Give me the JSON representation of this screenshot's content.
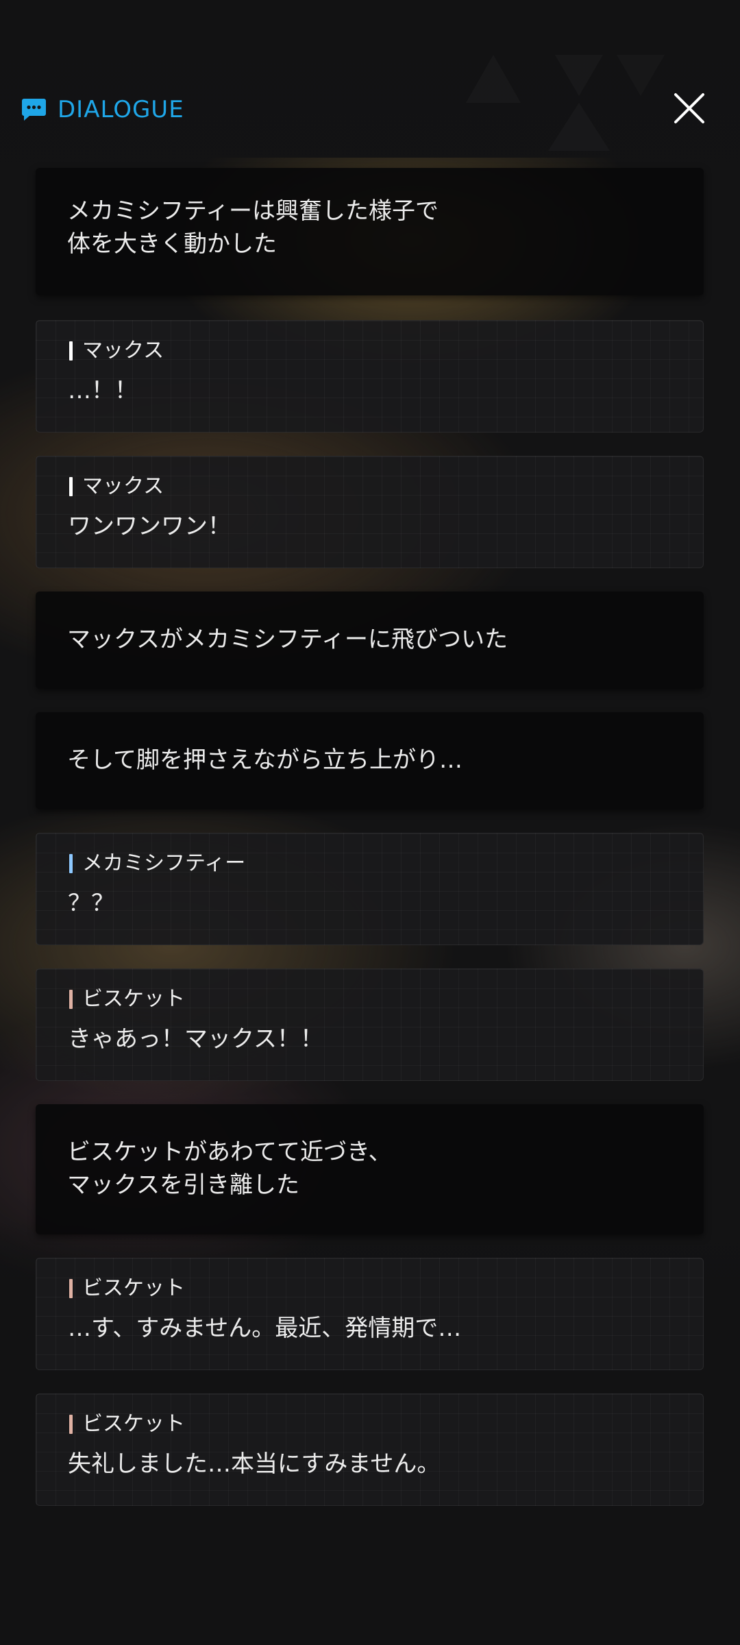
{
  "header": {
    "icon": "chat-bubble-icon",
    "title": "DIALOGUE",
    "close_icon": "close-icon"
  },
  "colors": {
    "accent": "#1fa6e8",
    "speaker_max": "#ffffff",
    "speaker_mecha": "#8ec9ff",
    "speaker_biscuit": "#e0b2a4"
  },
  "log": [
    {
      "type": "narration",
      "text": "メカミシフティーは興奮した様子で\n体を大きく動かした"
    },
    {
      "type": "speech",
      "speaker": "マックス",
      "text": "…！！"
    },
    {
      "type": "speech",
      "speaker": "マックス",
      "text": "ワンワンワン！"
    },
    {
      "type": "narration",
      "text": "マックスがメカミシフティーに飛びついた"
    },
    {
      "type": "narration",
      "text": "そして脚を押さえながら立ち上がり…"
    },
    {
      "type": "speech",
      "speaker": "メカミシフティー",
      "text": "？？"
    },
    {
      "type": "speech",
      "speaker": "ビスケット",
      "text": "きゃあっ！マックス！！"
    },
    {
      "type": "narration",
      "text": "ビスケットがあわてて近づき、\nマックスを引き離した"
    },
    {
      "type": "speech",
      "speaker": "ビスケット",
      "text": "…す、すみません。最近、発情期で…"
    },
    {
      "type": "speech",
      "speaker": "ビスケット",
      "text": "失礼しました…本当にすみません。"
    }
  ]
}
